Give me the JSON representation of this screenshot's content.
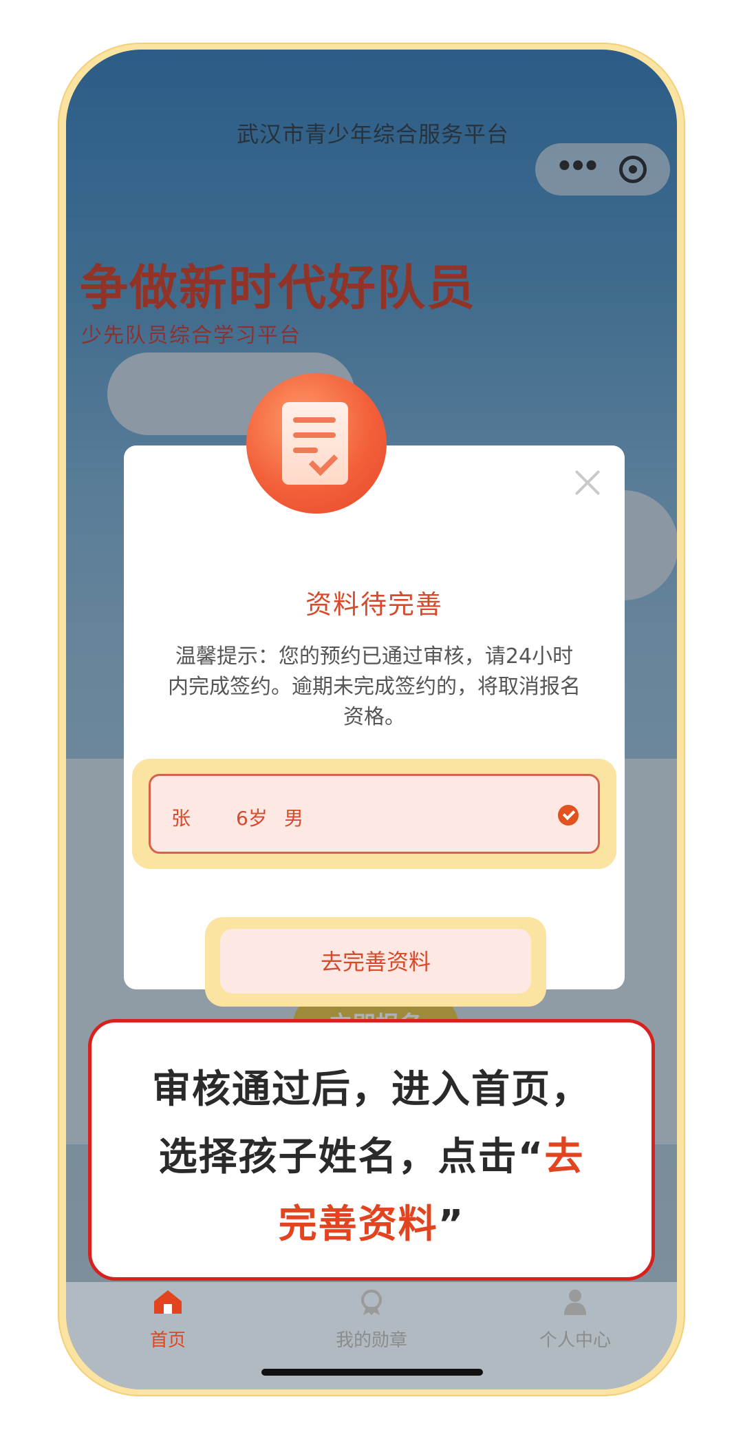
{
  "app": {
    "title": "武汉市青少年综合服务平台",
    "capsule_more": "•••"
  },
  "hero": {
    "title": "争做新时代好队员",
    "subtitle": "少先队员综合学习平台"
  },
  "background": {
    "enroll_button": "立即报名"
  },
  "modal": {
    "title": "资料待完善",
    "message_line1": "温馨提示：您的预约已通过审核，请24小时",
    "message_line2": "内完成签约。逾期未完成签约的，将取消报名",
    "message_line3": "资格。",
    "child": {
      "name": "张",
      "age": "6岁",
      "gender": "男",
      "selected": true
    },
    "action_button": "去完善资料"
  },
  "callout": {
    "line1": "审核通过后，进入首页，",
    "line2_prefix": "选择孩子姓名，点击“",
    "line2_highlight": "去",
    "line3_highlight": "完善资料",
    "line3_suffix": "”"
  },
  "tabbar": {
    "items": [
      {
        "label": "首页",
        "icon": "home-icon",
        "active": true
      },
      {
        "label": "我的勋章",
        "icon": "medal-icon",
        "active": false
      },
      {
        "label": "个人中心",
        "icon": "user-icon",
        "active": false
      }
    ]
  },
  "colors": {
    "accent": "#e2441f",
    "callout_border": "#d8201c",
    "frame": "#fbe3a2"
  }
}
